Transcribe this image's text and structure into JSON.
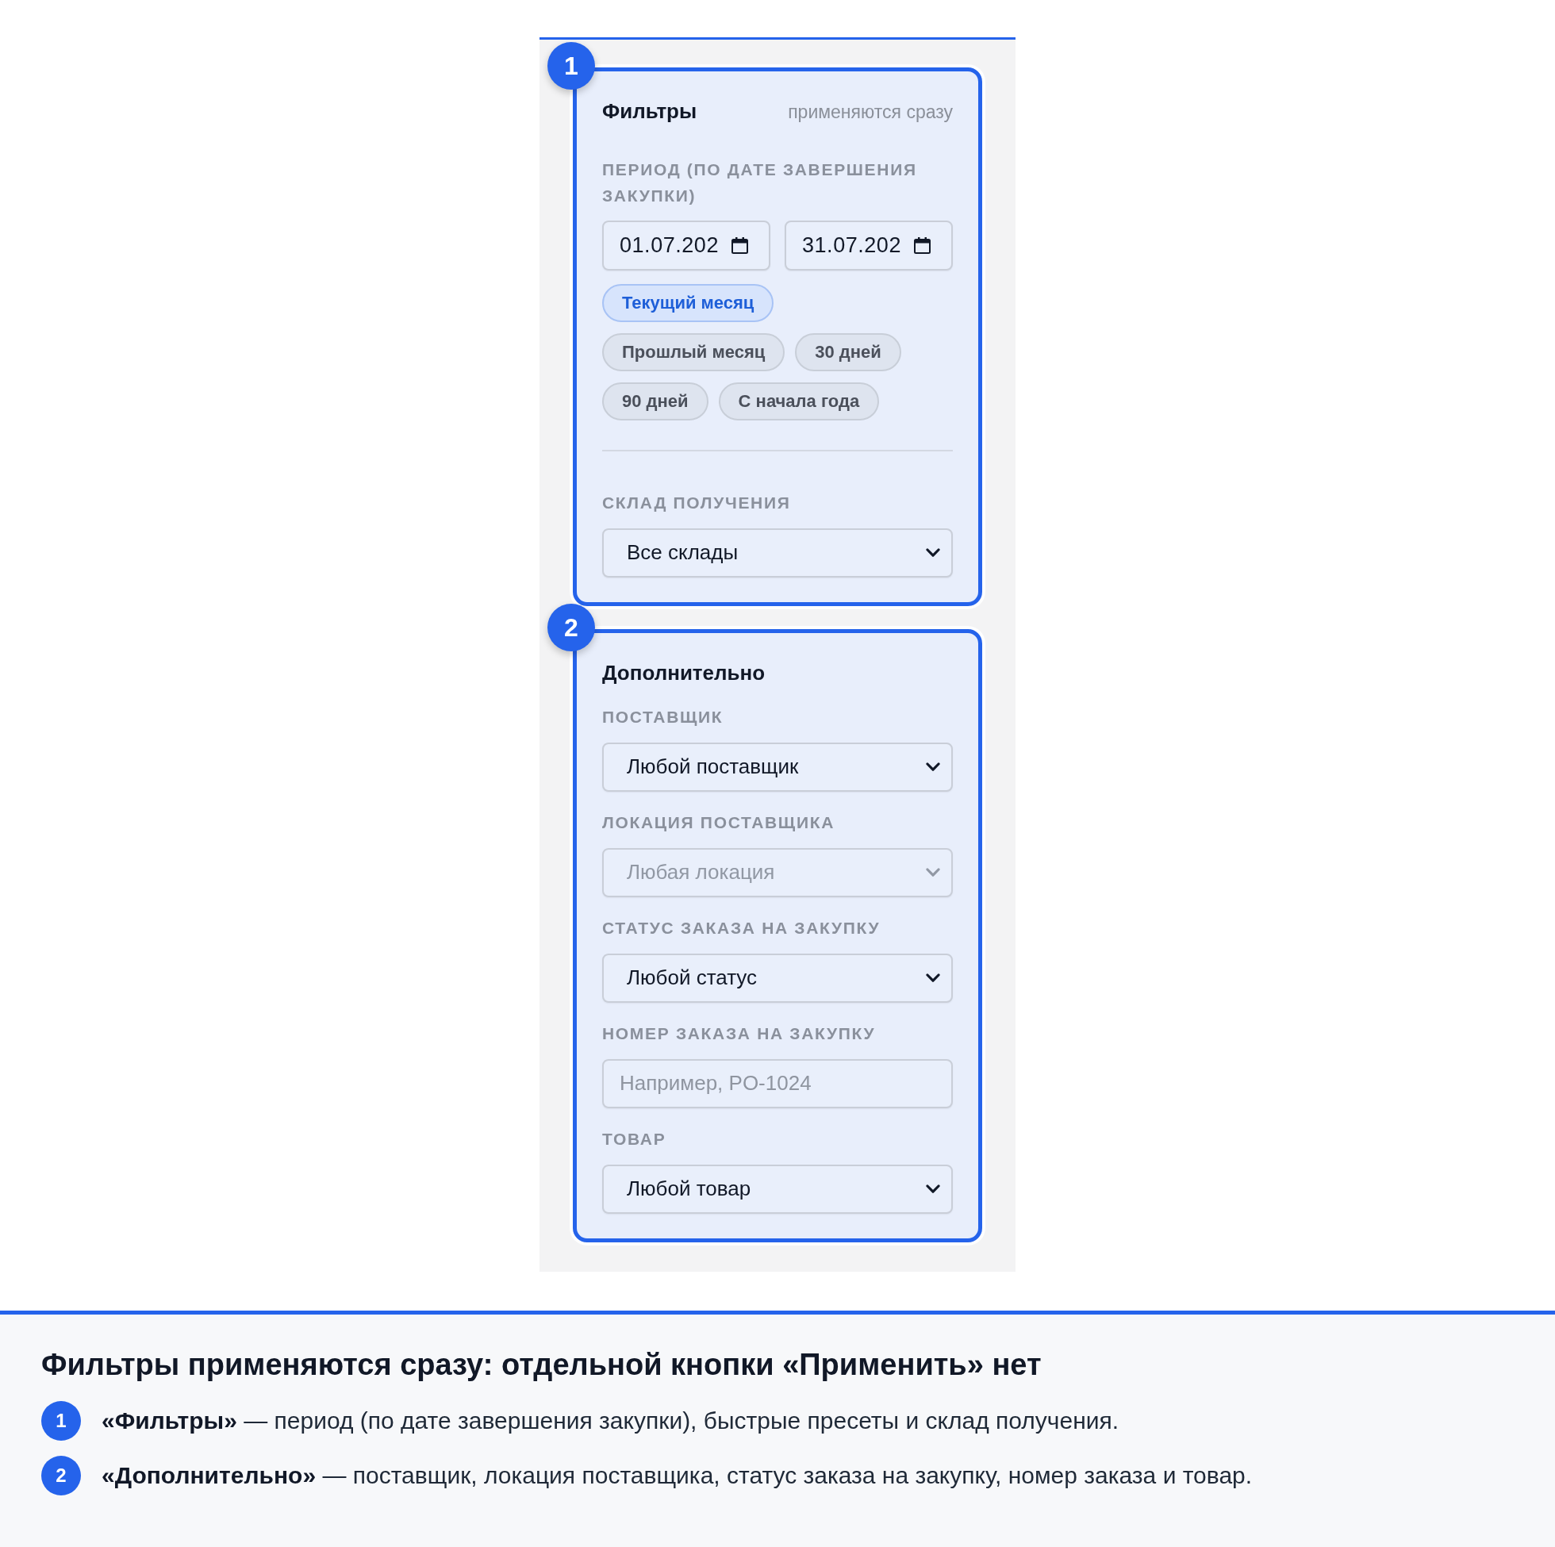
{
  "panel": {
    "sections": [
      {
        "number": "1",
        "title": "Фильтры",
        "hint": "применяются сразу",
        "fields": [
          {
            "kind": "date_range",
            "label": "ПЕРИОД (ПО ДАТЕ ЗАВЕРШЕНИЯ ЗАКУПКИ)",
            "start": "01.07.202",
            "end": "31.07.202",
            "disabled": false,
            "presets": [
              {
                "label": "Текущий месяц",
                "selected": true
              },
              {
                "label": "Прошлый месяц",
                "selected": false
              },
              {
                "label": "30 дней",
                "selected": false
              },
              {
                "label": "90 дней",
                "selected": false
              },
              {
                "label": "С начала года",
                "selected": false
              }
            ]
          },
          {
            "kind": "select",
            "label": "СКЛАД ПОЛУЧЕНИЯ",
            "value": "Все склады",
            "disabled": false
          }
        ]
      },
      {
        "number": "2",
        "title": "Дополнительно",
        "fields": [
          {
            "kind": "select",
            "label": "ПОСТАВЩИК",
            "value": "Любой поставщик",
            "disabled": false
          },
          {
            "kind": "select",
            "label": "ЛОКАЦИЯ ПОСТАВЩИКА",
            "value": "Любая локация",
            "disabled": true
          },
          {
            "kind": "select",
            "label": "СТАТУС ЗАКАЗА НА ЗАКУПКУ",
            "value": "Любой статус",
            "disabled": false
          },
          {
            "kind": "text",
            "label": "НОМЕР ЗАКАЗА НА ЗАКУПКУ",
            "placeholder": "Например, PO-1024",
            "disabled": false
          },
          {
            "kind": "select",
            "label": "ТОВАР",
            "value": "Любой товар",
            "disabled": false
          }
        ]
      }
    ]
  },
  "legend": {
    "title": "Фильтры применяются сразу: отдельной кнопки «Применить» нет",
    "items": [
      {
        "number": "1",
        "text": "**«Фильтры»** — период (по дате завершения закупки), быстрые пресеты и склад получения."
      },
      {
        "number": "2",
        "text": "**«Дополнительно»** — поставщик, локация поставщика, статус заказа на закупку, номер заказа и товар."
      }
    ]
  }
}
